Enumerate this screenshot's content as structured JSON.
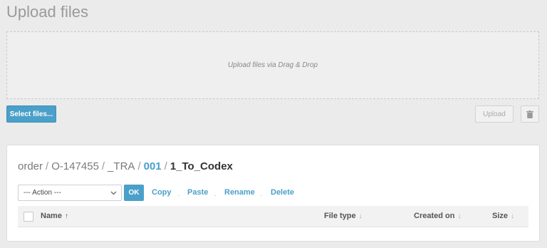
{
  "header": {
    "title": "Upload files"
  },
  "dropzone": {
    "hint": "Upload files via Drag & Drop"
  },
  "buttons": {
    "select_files": "Select files...",
    "upload": "Upload"
  },
  "breadcrumb": {
    "parts": [
      "order",
      "O-147455",
      "_TRA"
    ],
    "separator": "/",
    "link": "001",
    "current": "1_To_Codex"
  },
  "actions": {
    "select_value": "--- Action ---",
    "ok": "OK",
    "links": [
      "Copy",
      "Paste",
      "Rename",
      "Delete"
    ],
    "separator_dot": "."
  },
  "table": {
    "columns": [
      {
        "label": "Name",
        "sort": "asc"
      },
      {
        "label": "File type",
        "sort": "none"
      },
      {
        "label": "Created on",
        "sort": "none"
      },
      {
        "label": "Size",
        "sort": "none"
      }
    ]
  },
  "colors": {
    "accent": "#4aa0c9",
    "background": "#ebebeb"
  }
}
